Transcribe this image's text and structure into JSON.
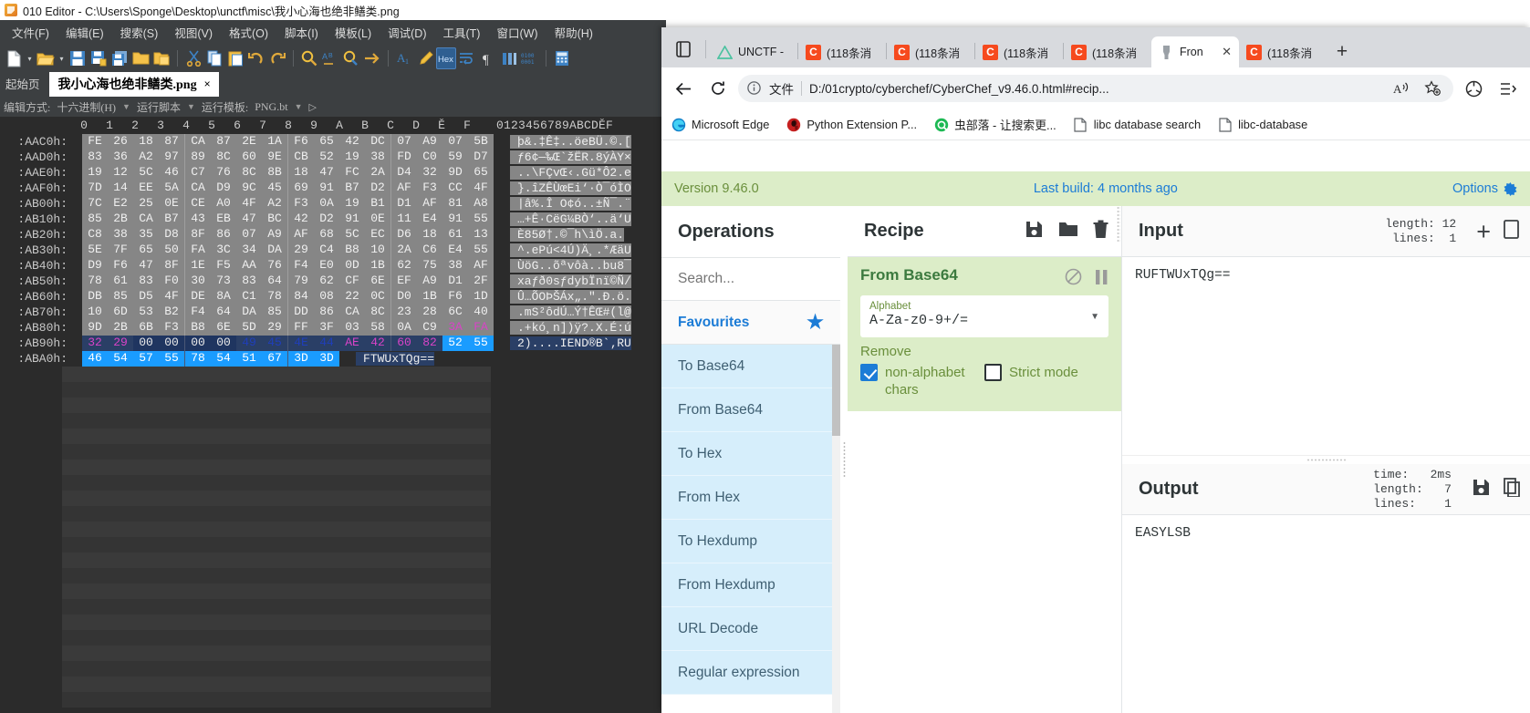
{
  "editor": {
    "title": "010 Editor - C:\\Users\\Sponge\\Desktop\\unctf\\misc\\我小心海也绝非鳝类.png",
    "menus": [
      "文件(F)",
      "编辑(E)",
      "搜索(S)",
      "视图(V)",
      "格式(O)",
      "脚本(I)",
      "模板(L)",
      "调试(D)",
      "工具(T)",
      "窗口(W)",
      "帮助(H)"
    ],
    "tabs": {
      "home": "起始页",
      "file": "我小心海也绝非鳝类.png",
      "close": "×"
    },
    "optionbar": {
      "edit_mode_label": "编辑方式:",
      "edit_mode_value": "十六进制(H)",
      "run_script": "运行脚本",
      "run_template_label": "运行模板:",
      "run_template_value": "PNG.bt"
    },
    "hex": {
      "column_headers": [
        "0",
        "1",
        "2",
        "3",
        "4",
        "5",
        "6",
        "7",
        "8",
        "9",
        "A",
        "B",
        "C",
        "D",
        "Ě",
        "F"
      ],
      "ascii_header": "0123456789ABCDĚF",
      "rows": [
        {
          "offset": ":AAC0h:",
          "bytes": [
            "FE",
            "26",
            "18",
            "87",
            "CA",
            "87",
            "2E",
            "1A",
            "F6",
            "65",
            "42",
            "DC",
            "07",
            "A9",
            "07",
            "5B"
          ],
          "ascii": "þ&.‡Ê‡..öeBÜ.©.["
        },
        {
          "offset": ":AAD0h:",
          "bytes": [
            "83",
            "36",
            "A2",
            "97",
            "89",
            "8C",
            "60",
            "9E",
            "CB",
            "52",
            "19",
            "38",
            "FD",
            "C0",
            "59",
            "D7"
          ],
          "ascii": "ƒ6¢—‰Œ`žËR.8ýÀY×"
        },
        {
          "offset": ":AAE0h:",
          "bytes": [
            "19",
            "12",
            "5C",
            "46",
            "C7",
            "76",
            "8C",
            "8B",
            "18",
            "47",
            "FC",
            "2A",
            "D4",
            "32",
            "9D",
            "65"
          ],
          "ascii": "..\\FÇvŒ‹.Gü*Ô2.e"
        },
        {
          "offset": ":AAF0h:",
          "bytes": [
            "7D",
            "14",
            "EE",
            "5A",
            "CA",
            "D9",
            "9C",
            "45",
            "69",
            "91",
            "B7",
            "D2",
            "AF",
            "F3",
            "CC",
            "4F"
          ],
          "ascii": "}.îZÊÙœEi‘·Ò¯óÌO"
        },
        {
          "offset": ":AB00h:",
          "bytes": [
            "7C",
            "E2",
            "25",
            "0E",
            "CE",
            "A0",
            "4F",
            "A2",
            "F3",
            "0A",
            "19",
            "B1",
            "D1",
            "AF",
            "81",
            "A8"
          ],
          "ascii": "|â%.Î O¢ó..±Ñ¯.¨"
        },
        {
          "offset": ":AB10h:",
          "bytes": [
            "85",
            "2B",
            "CA",
            "B7",
            "43",
            "EB",
            "47",
            "BC",
            "42",
            "D2",
            "91",
            "0E",
            "11",
            "E4",
            "91",
            "55"
          ],
          "ascii": "…+Ê·CëG¼BÒ‘..ä‘U"
        },
        {
          "offset": ":AB20h:",
          "bytes": [
            "C8",
            "38",
            "35",
            "D8",
            "8F",
            "86",
            "07",
            "A9",
            "AF",
            "68",
            "5C",
            "EC",
            "D6",
            "18",
            "61",
            "13"
          ],
          "ascii": "È85Ø†.©¯h\\ìÖ.a."
        },
        {
          "offset": ":AB30h:",
          "bytes": [
            "5E",
            "7F",
            "65",
            "50",
            "FA",
            "3C",
            "34",
            "DA",
            "29",
            "C4",
            "B8",
            "10",
            "2A",
            "C6",
            "E4",
            "55"
          ],
          "ascii": "^.ePú<4Ú)Ä¸.*ÆäU"
        },
        {
          "offset": ":AB40h:",
          "bytes": [
            "D9",
            "F6",
            "47",
            "8F",
            "1E",
            "F5",
            "AA",
            "76",
            "F4",
            "E0",
            "0D",
            "1B",
            "62",
            "75",
            "38",
            "AF"
          ],
          "ascii": "ÙöG..õªvôà..bu8¯"
        },
        {
          "offset": ":AB50h:",
          "bytes": [
            "78",
            "61",
            "83",
            "F0",
            "30",
            "73",
            "83",
            "64",
            "79",
            "62",
            "CF",
            "6E",
            "EF",
            "A9",
            "D1",
            "2F"
          ],
          "ascii": "xaƒð0sƒdybÏnï©Ñ/"
        },
        {
          "offset": ":AB60h:",
          "bytes": [
            "DB",
            "85",
            "D5",
            "4F",
            "DE",
            "8A",
            "C1",
            "78",
            "84",
            "08",
            "22",
            "0C",
            "D0",
            "1B",
            "F6",
            "1D"
          ],
          "ascii": "Û…ÕOÞŠÁx„.\".Ð.ö."
        },
        {
          "offset": ":AB70h:",
          "bytes": [
            "10",
            "6D",
            "53",
            "B2",
            "F4",
            "64",
            "DA",
            "85",
            "DD",
            "86",
            "CA",
            "8C",
            "23",
            "28",
            "6C",
            "40"
          ],
          "ascii": ".mS²ôdÚ…Ý†ÊŒ#(l@"
        },
        {
          "offset": ":AB80h:",
          "bytes": [
            "9D",
            "2B",
            "6B",
            "F3",
            "B8",
            "6E",
            "5D",
            "29",
            "FF",
            "3F",
            "03",
            "58",
            "0A",
            "C9",
            "3A",
            "FA"
          ],
          "ascii": ".+kó¸n])ÿ?.X.É:ú"
        }
      ],
      "selected_rows": [
        {
          "offset": ":AB90h:",
          "bytes": [
            "32",
            "29",
            "00",
            "00",
            "00",
            "00",
            "49",
            "45",
            "4E",
            "44",
            "AE",
            "42",
            "60",
            "82",
            "52",
            "55"
          ],
          "ascii": "2)....IEND®B`‚RU"
        },
        {
          "offset": ":ABA0h:",
          "bytes": [
            "46",
            "54",
            "57",
            "55",
            "78",
            "54",
            "51",
            "67",
            "3D",
            "3D"
          ],
          "ascii": "FTWUxTQg=="
        }
      ]
    }
  },
  "browser": {
    "tabs": [
      {
        "label": "UNCTF -",
        "icon": "unctf-icon",
        "active": false
      },
      {
        "label": "(118条消",
        "icon": "csdn-icon",
        "active": false
      },
      {
        "label": "(118条消",
        "icon": "csdn-icon",
        "active": false
      },
      {
        "label": "(118条消",
        "icon": "csdn-icon",
        "active": false
      },
      {
        "label": "(118条消",
        "icon": "csdn-icon",
        "active": false
      },
      {
        "label": "Fron",
        "icon": "cyberchef-icon",
        "active": true
      },
      {
        "label": "(118条消",
        "icon": "csdn-icon",
        "active": false
      }
    ],
    "new_tab": "+",
    "tab_close": "✕",
    "address": {
      "info_icon": "info-icon",
      "file_label": "文件",
      "url": "D:/01crypto/cyberchef/CyberChef_v9.46.0.html#recip...",
      "read_aloud": "A",
      "favorite": "favorite-icon",
      "collections": "collections-icon",
      "sidebar": "sidebar-icon"
    },
    "bookmarks": [
      {
        "label": "Microsoft Edge",
        "icon": "edge-icon"
      },
      {
        "label": "Python Extension P...",
        "icon": "python-icon"
      },
      {
        "label": "虫部落 - 让搜索更...",
        "icon": "chongbuluo-icon"
      },
      {
        "label": "libc database search",
        "icon": "page-icon"
      },
      {
        "label": "libc-database",
        "icon": "page-icon"
      }
    ]
  },
  "cyberchef": {
    "banner": {
      "version": "Version 9.46.0",
      "last_build": "Last build: 4 months ago",
      "options": "Options"
    },
    "operations": {
      "title": "Operations",
      "search_placeholder": "Search...",
      "favourites": "Favourites",
      "items": [
        "To Base64",
        "From Base64",
        "To Hex",
        "From Hex",
        "To Hexdump",
        "From Hexdump",
        "URL Decode",
        "Regular expression"
      ]
    },
    "recipe": {
      "title": "Recipe",
      "icons": [
        "save-icon",
        "folder-icon",
        "trash-icon"
      ],
      "operation": {
        "name": "From Base64",
        "disable_icon": "disable-icon",
        "pause_icon": "pause-icon",
        "alphabet_label": "Alphabet",
        "alphabet_value": "A-Za-z0-9+/=",
        "remove_label": "Remove",
        "checkbox1_label": "non-alphabet chars",
        "checkbox1_checked": true,
        "checkbox2_label": "Strict mode",
        "checkbox2_checked": false
      }
    },
    "input": {
      "title": "Input",
      "meta": "length: 12\nlines:  1",
      "value": "RUFTWUxTQg==",
      "add_icon": "+",
      "open_icon": "open-file-icon"
    },
    "output": {
      "title": "Output",
      "meta": "time:   2ms\nlength:   7\nlines:    1",
      "value": "EASYLSB",
      "save_icon": "save-icon",
      "copy_icon": "copy-icon"
    }
  },
  "colors": {
    "cyberchef_green": "#dcedc8",
    "cyberchef_link": "#1c7cd6",
    "op_blue": "#d6eefb",
    "hex_selection": "#1a9cff",
    "hex_bg": "#868686"
  }
}
